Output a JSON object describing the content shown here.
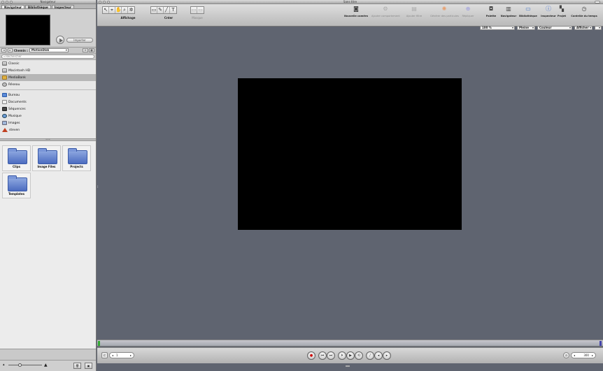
{
  "browser": {
    "title": "Navigateur",
    "tabs": [
      {
        "label": "Navigateur",
        "active": true
      },
      {
        "label": "Bibliothèque",
        "active": false
      },
      {
        "label": "Inspecteur",
        "active": false
      }
    ],
    "import_label": "Importer",
    "path_label": "Chemin :",
    "path_value": "MotionDisk",
    "search_placeholder": "Rechercher",
    "sources": [
      {
        "label": "Classic",
        "icon": "disk-icon"
      },
      {
        "label": "Macintosh HD",
        "icon": "disk-icon"
      },
      {
        "label": "MediaBank",
        "icon": "folder-icon",
        "selected": true
      },
      {
        "label": "Réseau",
        "icon": "network-icon"
      }
    ],
    "places": [
      {
        "label": "Bureau",
        "icon": "desktop-icon"
      },
      {
        "label": "Documents",
        "icon": "documents-icon"
      },
      {
        "label": "Séquences",
        "icon": "movies-icon"
      },
      {
        "label": "Musique",
        "icon": "music-icon"
      },
      {
        "label": "Images",
        "icon": "pictures-icon"
      },
      {
        "label": "steven",
        "icon": "home-icon"
      }
    ],
    "files": [
      {
        "label": "Clips"
      },
      {
        "label": "Image Files"
      },
      {
        "label": "Projects"
      },
      {
        "label": "Templates"
      }
    ]
  },
  "main": {
    "title": "Sans titre",
    "toolbar": {
      "affichage_label": "Affichage",
      "creer_label": "Créer",
      "masque_label": "Masque",
      "nouvelle_camera": "Nouvelle caméra",
      "ajouter_comportement": "Ajouter comportement",
      "ajouter_filtre": "Ajouter filtre",
      "generer_particules": "Générer des particules",
      "repliquer": "Répliquer",
      "palette": "Palette",
      "navigateur": "Navigateur",
      "bibliotheque": "Bibliothèque",
      "inspecteur": "Inspecteur",
      "projet": "Projet",
      "controle_temps": "Contrôle du temps"
    },
    "view": {
      "zoom": "100 %",
      "quality": "Pleine",
      "channel": "Couleur",
      "show": "Afficher"
    },
    "transport": {
      "current_frame": "1",
      "end_frame": "300"
    }
  },
  "colors": {
    "canvas_bg": "#5f6470",
    "stage": "#000000",
    "panel": "#c9c9c9"
  }
}
